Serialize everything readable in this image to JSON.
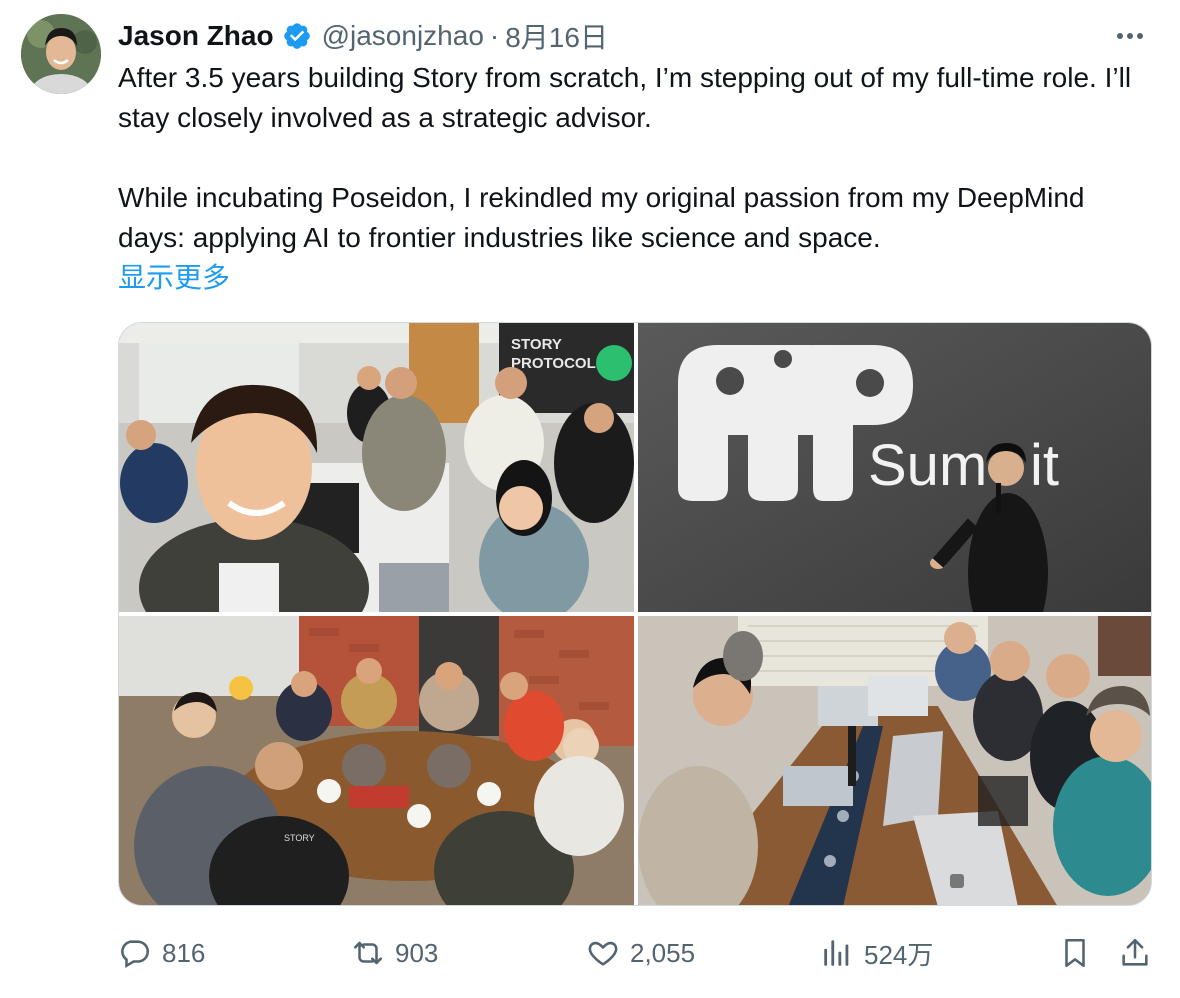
{
  "author": {
    "name": "Jason Zhao",
    "handle": "@jasonjzhao",
    "separator": "·",
    "date": "8月16日",
    "verified_color": "#1d9bf0"
  },
  "tweet": {
    "paragraph1": "After 3.5 years building Story from scratch, I’m stepping out of my full-time role. I’ll stay closely involved as a strategic advisor.",
    "paragraph2": "While incubating Poseidon, I rekindled my original passion from my DeepMind days: applying AI to frontier industries like science and space.",
    "show_more": "显示更多"
  },
  "media": {
    "photo1": {
      "banner_text": "STORY\nPROTOCOL"
    },
    "photo2": {
      "event_text": "Summit"
    },
    "photo3": {
      "shirt_text": "STORY"
    }
  },
  "actions": {
    "replies": "816",
    "reposts": "903",
    "likes": "2,055",
    "views": "524万"
  },
  "icons": {
    "reply": "reply-icon",
    "repost": "repost-icon",
    "like": "heart-icon",
    "views": "views-chart-icon",
    "bookmark": "bookmark-icon",
    "share": "share-icon",
    "more": "more-options-icon",
    "verified": "verified-badge-icon"
  },
  "colors": {
    "text": "#0f1419",
    "secondary": "#536471",
    "link": "#1d9bf0"
  }
}
